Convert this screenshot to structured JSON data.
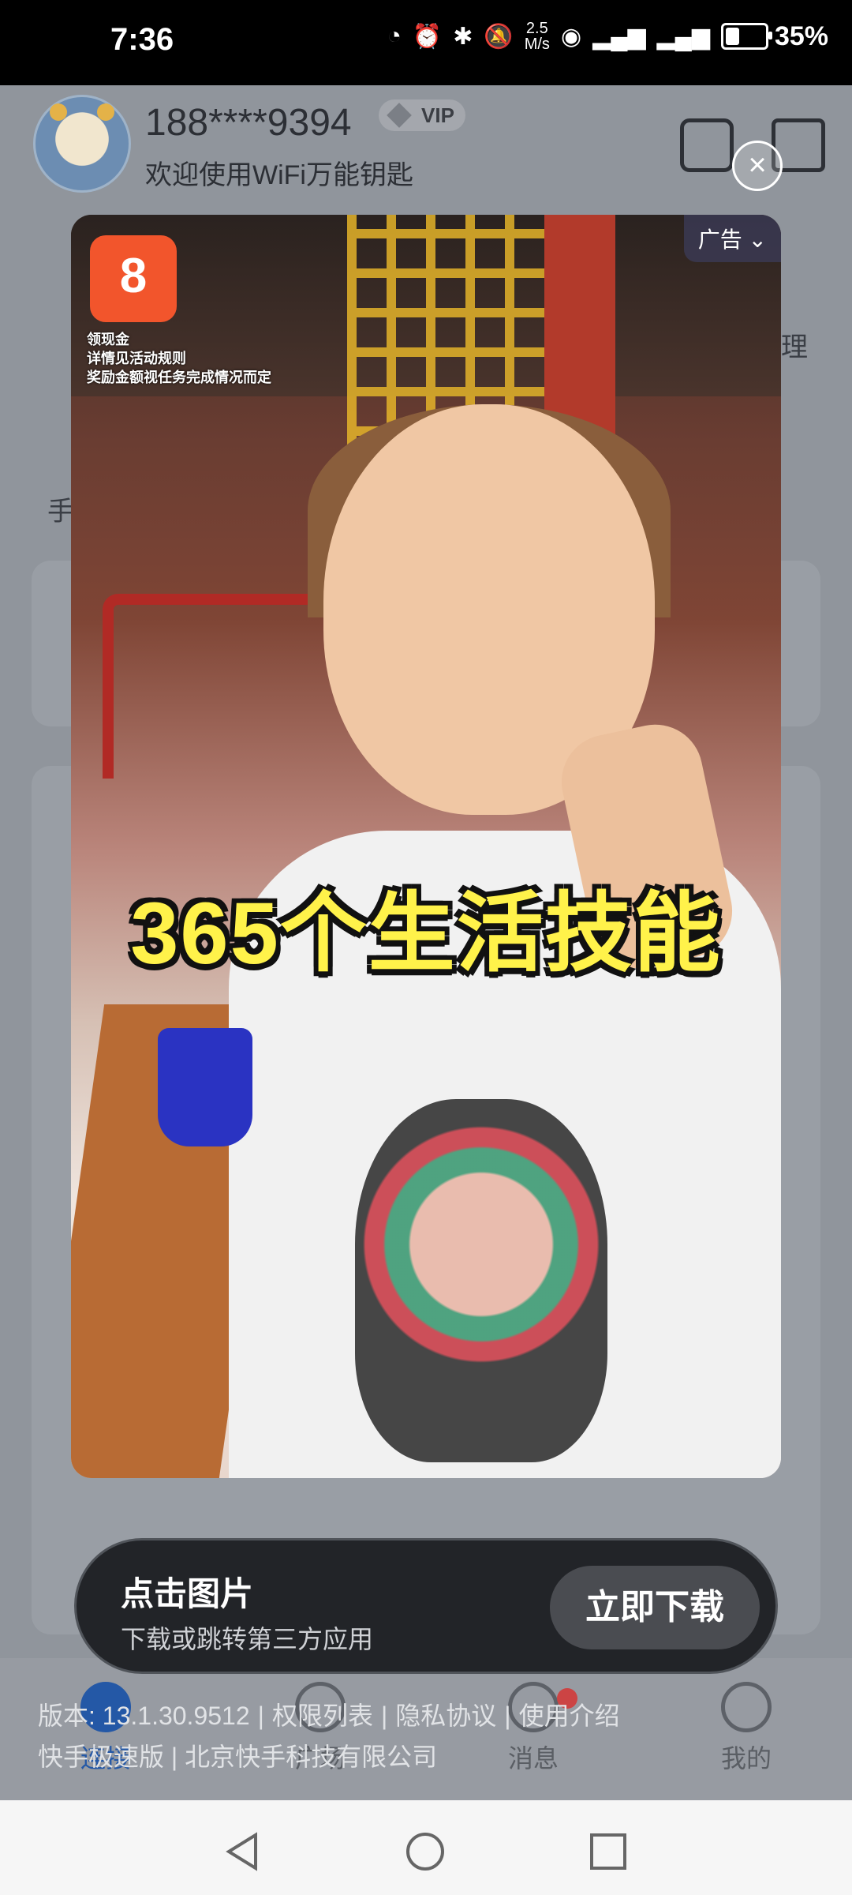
{
  "status_bar": {
    "time": "7:36",
    "speed_value": "2.5",
    "speed_unit": "M/s",
    "battery": "35%",
    "battery_level": 0.35
  },
  "profile": {
    "phone": "188****9394",
    "vip_label": "VIP",
    "welcome": "欢迎使用WiFi万能钥匙"
  },
  "background_fragments": {
    "right_text": "理",
    "left_text": "手"
  },
  "bottom_nav": {
    "items": [
      {
        "label": "连接",
        "active": true
      },
      {
        "label": "广场",
        "active": false
      },
      {
        "label": "消息",
        "active": false
      },
      {
        "label": "我的",
        "active": false
      }
    ]
  },
  "footer_info": {
    "version": "版本: 13.1.30.9512",
    "permissions": "权限列表",
    "privacy": "隐私协议",
    "intro": "使用介绍",
    "company": "快手极速版 | 北京快手科技有限公司"
  },
  "ad": {
    "tag": "广告",
    "logo_badge": "领现金",
    "small_print_1": "详情见活动规则",
    "small_print_2": "奖励金额视任务完成情况而定",
    "headline": "365个生活技能",
    "cta_title": "点击图片",
    "cta_subtitle": "下载或跳转第三方应用",
    "cta_button": "立即下载"
  }
}
